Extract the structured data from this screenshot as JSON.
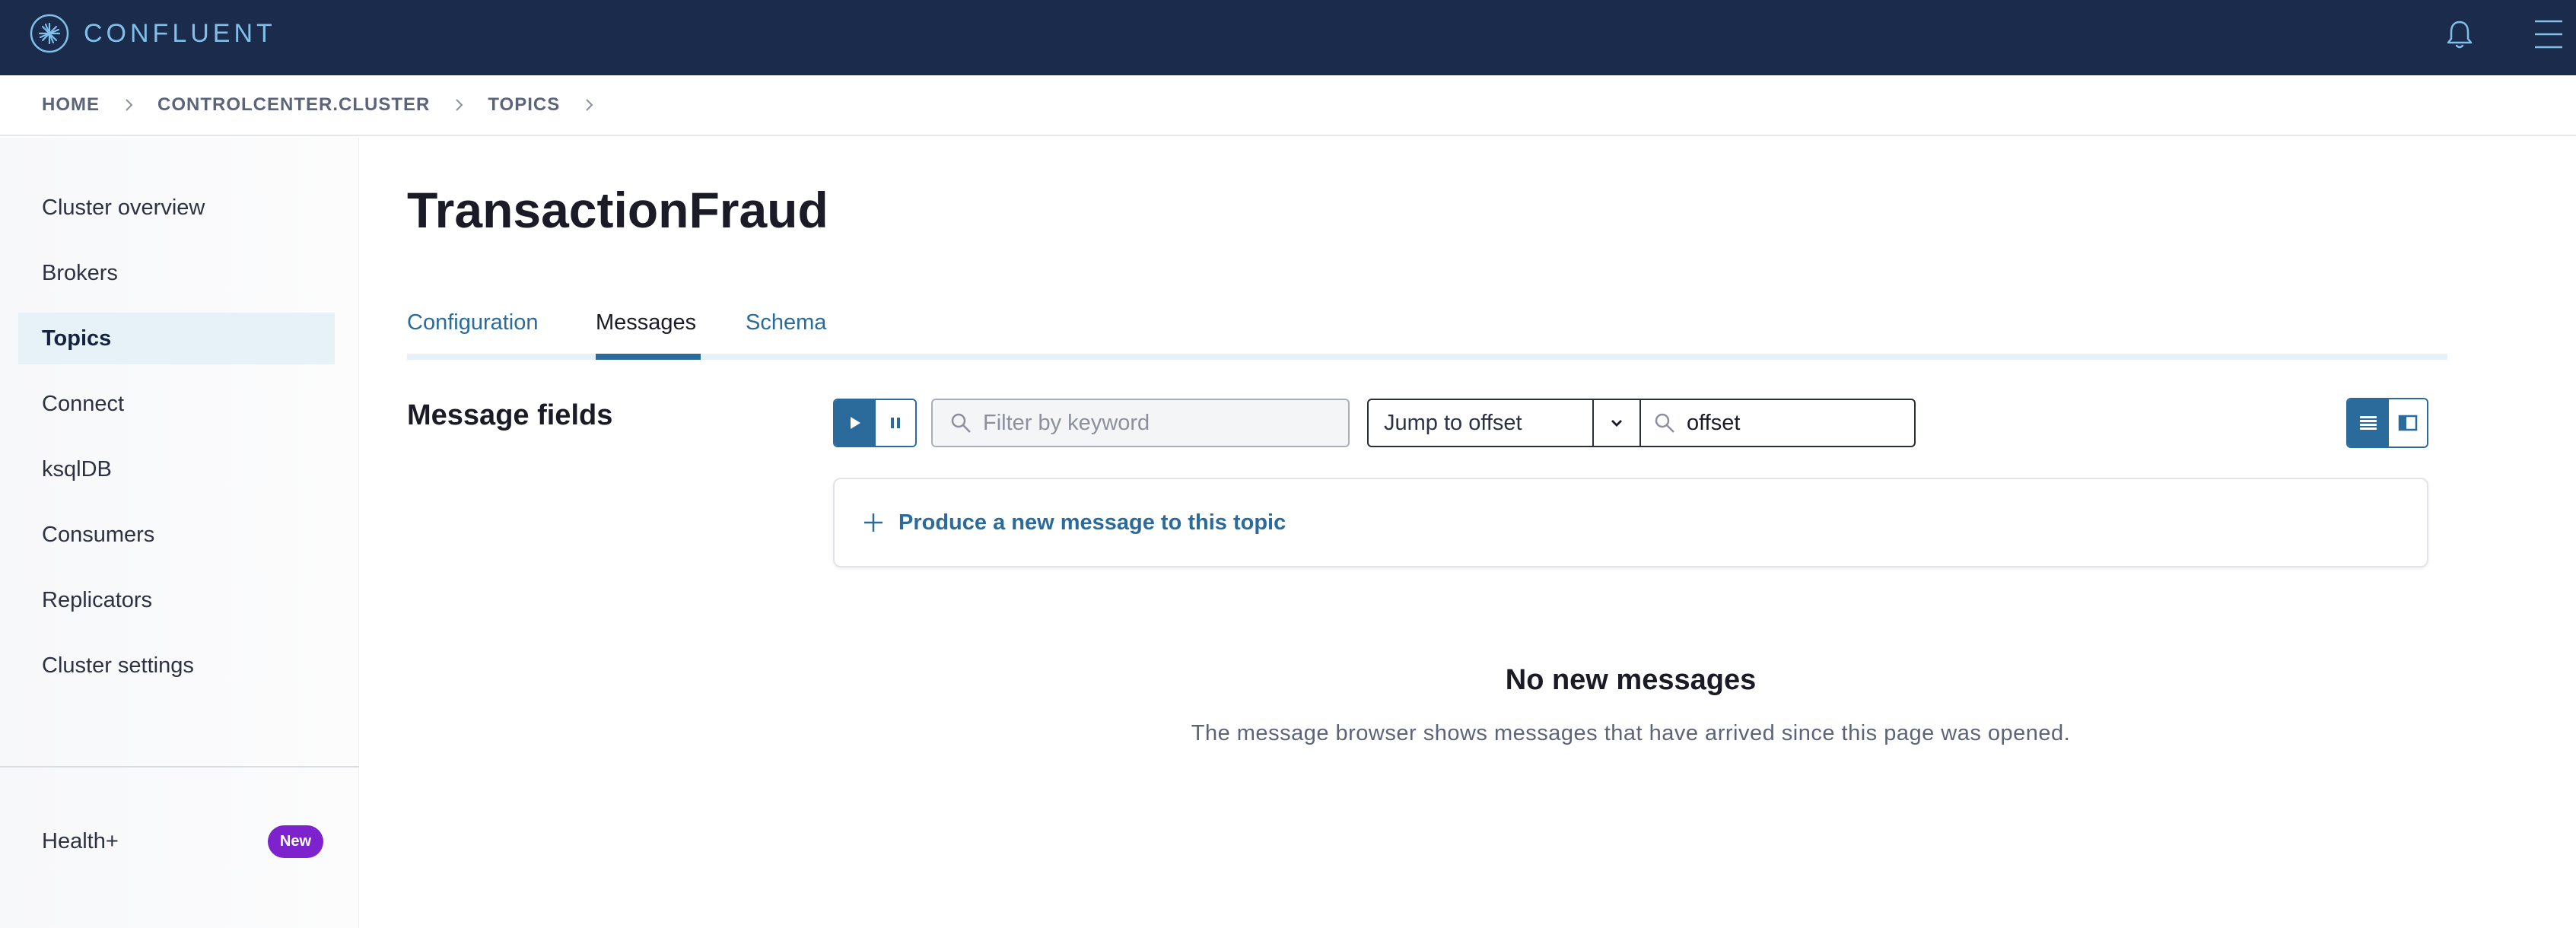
{
  "app": {
    "brand": "CONFLUENT",
    "colors": {
      "navbar": "#1b2b4b",
      "accent": "#2a6b9c",
      "badge": "#7e22ce"
    }
  },
  "header": {
    "icons": [
      "confluent-logo-icon",
      "bell-icon",
      "hamburger-menu-icon"
    ]
  },
  "breadcrumb": {
    "items": [
      "HOME",
      "CONTROLCENTER.CLUSTER",
      "TOPICS"
    ]
  },
  "sidebar": {
    "items": [
      {
        "label": "Cluster overview"
      },
      {
        "label": "Brokers"
      },
      {
        "label": "Topics",
        "active": true
      },
      {
        "label": "Connect"
      },
      {
        "label": "ksqlDB"
      },
      {
        "label": "Consumers"
      },
      {
        "label": "Replicators"
      },
      {
        "label": "Cluster settings"
      }
    ],
    "health": {
      "label": "Health+",
      "badge": "New"
    }
  },
  "main": {
    "title": "TransactionFraud",
    "tabs": [
      {
        "label": "Configuration"
      },
      {
        "label": "Messages",
        "active": true
      },
      {
        "label": "Schema"
      }
    ],
    "message_fields_title": "Message fields",
    "filter": {
      "placeholder": "Filter by keyword",
      "value": ""
    },
    "jump": {
      "label": "Jump to offset"
    },
    "offset": {
      "placeholder": "offset",
      "value": "offset"
    },
    "produce_label": "Produce a new message to this topic",
    "empty": {
      "title": "No new messages",
      "text": "The message browser shows messages that have arrived since this page was opened."
    }
  }
}
